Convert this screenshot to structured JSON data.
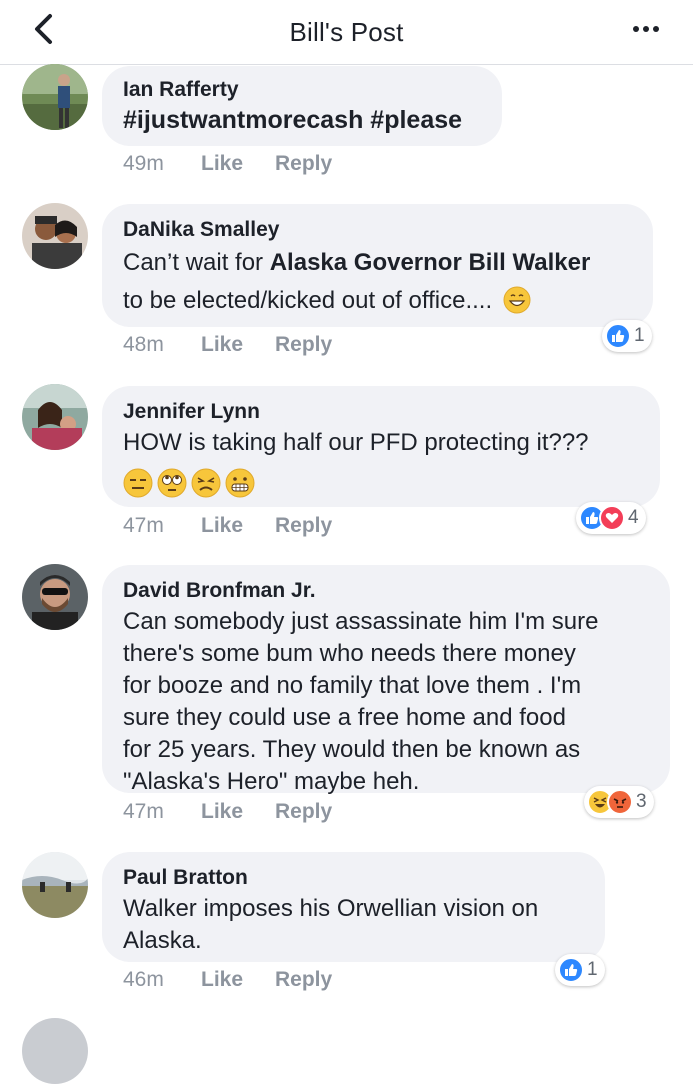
{
  "header": {
    "title": "Bill's Post"
  },
  "comments": [
    {
      "author": "Ian Rafferty",
      "text": "#ijustwantmorecash #please",
      "time": "49m",
      "like": "Like",
      "reply": "Reply"
    },
    {
      "author": "DaNika Smalley",
      "text_pre": "Can’t wait for ",
      "text_bold": "Alaska Governor Bill Walker",
      "text_post": "to be elected/kicked out of office....",
      "emoji": "grinning-face",
      "time": "48m",
      "like": "Like",
      "reply": "Reply",
      "reactions": {
        "types": [
          "like"
        ],
        "count": "1"
      }
    },
    {
      "author": "Jennifer Lynn",
      "text": "HOW is taking half our PFD protecting it???",
      "emojis": [
        "expressionless-face",
        "face-with-rolling-eyes",
        "confounded-face",
        "grimacing-face"
      ],
      "time": "47m",
      "like": "Like",
      "reply": "Reply",
      "reactions": {
        "types": [
          "like",
          "love"
        ],
        "count": "4"
      }
    },
    {
      "author": "David Bronfman Jr.",
      "lines": [
        "Can somebody just assassinate him I'm sure",
        "there's some bum who needs there money",
        "for booze and no family that love them . I'm",
        "sure they could use a free home and food",
        "for 25 years. They would then be known as",
        "\"Alaska's Hero\" maybe heh."
      ],
      "time": "47m",
      "like": "Like",
      "reply": "Reply",
      "reactions": {
        "types": [
          "haha",
          "angry"
        ],
        "count": "3"
      }
    },
    {
      "author": "Paul Bratton",
      "lines": [
        "Walker imposes his Orwellian vision on",
        "Alaska."
      ],
      "time": "46m",
      "like": "Like",
      "reply": "Reply",
      "reactions": {
        "types": [
          "like"
        ],
        "count": "1"
      }
    }
  ],
  "colors": {
    "like_blue": "#2d88ff",
    "love_red": "#f33e58",
    "bubble": "#f1f2f6",
    "meta_gray": "#8d949e"
  }
}
